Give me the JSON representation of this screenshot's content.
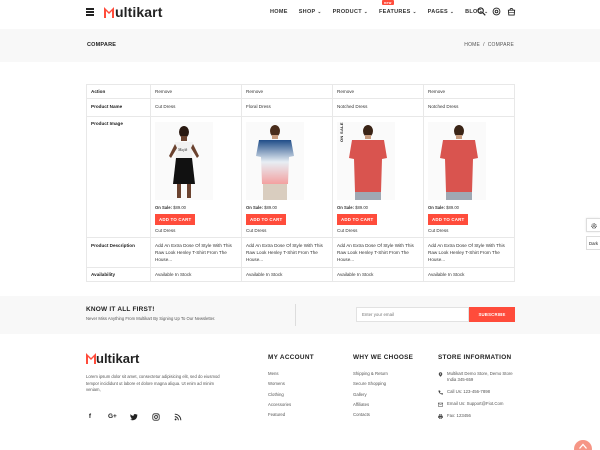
{
  "header": {
    "logo_text": "ultikart",
    "nav": [
      {
        "label": "HOME"
      },
      {
        "label": "SHOP"
      },
      {
        "label": "PRODUCT"
      },
      {
        "label": "FEATURES",
        "badge": "new"
      },
      {
        "label": "PAGES"
      },
      {
        "label": "BLOG"
      }
    ],
    "icons": [
      "search-icon",
      "settings-icon",
      "cart-icon"
    ]
  },
  "breadcrumb": {
    "title": "COMPARE",
    "home": "HOME",
    "separator": "/",
    "current": "COMPARE"
  },
  "compare": {
    "labels": {
      "action": "Action",
      "name": "Product Name",
      "image": "Product Image",
      "description": "Product Description",
      "availability": "Availability"
    },
    "products": [
      {
        "action": "Remove",
        "name": "Cut Dress",
        "sale_label": "On Sale:",
        "price": "$89.00",
        "button": "ADD TO CART",
        "subname": "Cut Dress",
        "description": "Add An Extra Dose Of Style With This Raw Look Henley T-Shirt From The House...",
        "availability": "Available In Stock",
        "tag": ""
      },
      {
        "action": "Remove",
        "name": "Floral Dress",
        "sale_label": "On Sale:",
        "price": "$89.00",
        "button": "ADD TO CART",
        "subname": "Cut Dress",
        "description": "Add An Extra Dose Of Style With This Raw Look Henley T-Shirt From The House...",
        "availability": "Available In Stock",
        "tag": ""
      },
      {
        "action": "Remove",
        "name": "Notched Dress",
        "sale_label": "On Sale:",
        "price": "$89.00",
        "button": "ADD TO CART",
        "subname": "Cut Dress",
        "description": "Add An Extra Dose Of Style With This Raw Look Henley T-Shirt From The House...",
        "availability": "Available In Stock",
        "tag": "ON SALE"
      },
      {
        "action": "Remove",
        "name": "Notched Dress",
        "sale_label": "On Sale:",
        "price": "$89.00",
        "button": "ADD TO CART",
        "subname": "Cut Dress",
        "description": "Add An Extra Dose Of Style With This Raw Look Henley T-Shirt From The House...",
        "availability": "Available In Stock",
        "tag": ""
      }
    ]
  },
  "newsletter": {
    "title": "KNOW IT ALL FIRST!",
    "subtitle": "Never Miss Anything From Multikart By Signing Up To Our Newsletter.",
    "placeholder": "Enter your email",
    "button": "SUBSCRIBE"
  },
  "footer": {
    "logo_text": "ultikart",
    "about": "Lorem ipsum dolor sit amet, consectetur adipisicing elit, sed do eiusmod tempor incididunt ut labore et dolore magna aliqua. Ut enim ad minim veniam,",
    "socials": [
      "facebook-icon",
      "google-plus-icon",
      "twitter-icon",
      "instagram-icon",
      "rss-icon"
    ],
    "my_account": {
      "title": "MY ACCOUNT",
      "items": [
        "Mens",
        "Womens",
        "Clothing",
        "Accessories",
        "Featured"
      ]
    },
    "why_we_choose": {
      "title": "WHY WE CHOOSE",
      "items": [
        "Shipping & Return",
        "Secure Shopping",
        "Gallery",
        "Affiliates",
        "Contacts"
      ]
    },
    "store_information": {
      "title": "STORE INFORMATION",
      "items": [
        {
          "icon": "map-marker-icon",
          "text": "Multikart Demo Store, Demo Store India 345-659"
        },
        {
          "icon": "phone-icon",
          "text": "Call Us: 123-456-7898"
        },
        {
          "icon": "envelope-icon",
          "text": "Email Us: Support@Fiot.Com"
        },
        {
          "icon": "fax-icon",
          "text": "Fax: 123456"
        }
      ]
    }
  },
  "side": {
    "dark_label": "Dark"
  },
  "colors": {
    "accent": "#ff4c3b",
    "light_bg": "#f8f8f8"
  }
}
